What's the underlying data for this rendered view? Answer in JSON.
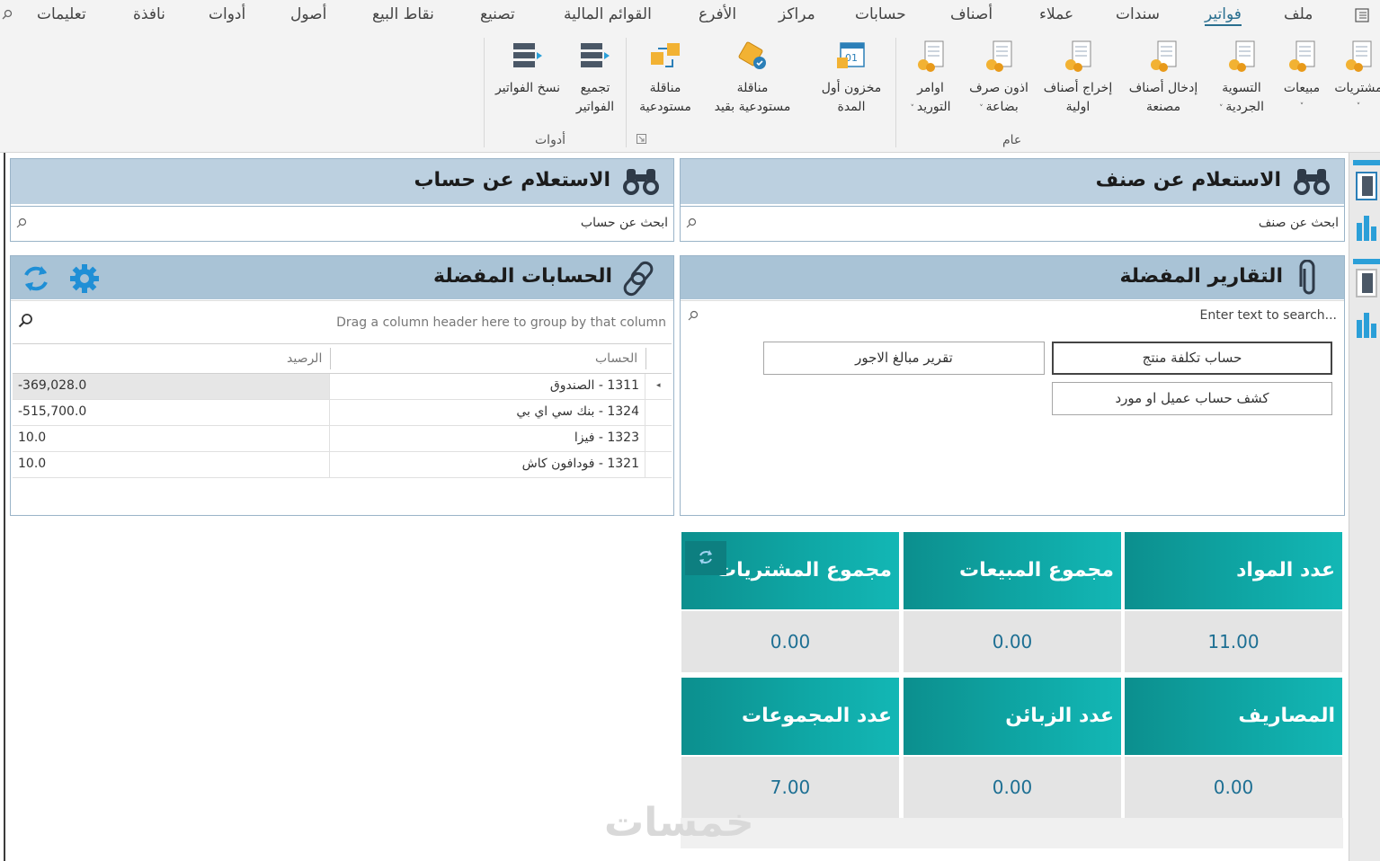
{
  "menu": {
    "items": [
      "ملف",
      "فواتير",
      "سندات",
      "عملاء",
      "أصناف",
      "حسابات",
      "مراكز",
      "الأفرع",
      "القوائم المالية",
      "تصنيع",
      "نقاط البيع",
      "أصول",
      "أدوات",
      "نافذة",
      "تعليمات"
    ],
    "active": "فواتير"
  },
  "ribbon": {
    "buttons": [
      {
        "line1": "مشتريات",
        "line2": "",
        "dropdown": true
      },
      {
        "line1": "مبيعات",
        "line2": "",
        "dropdown": true
      },
      {
        "line1": "التسوية",
        "line2": "الجردية",
        "dropdown": true
      },
      {
        "line1": "إدخال أصناف",
        "line2": "مصنعة",
        "dropdown": false
      },
      {
        "line1": "إخراج أصناف",
        "line2": "اولية",
        "dropdown": false
      },
      {
        "line1": "اذون صرف",
        "line2": "بضاعة",
        "dropdown": true
      },
      {
        "line1": "اوامر",
        "line2": "التوريد",
        "dropdown": true
      },
      {
        "line1": "مخزون أول",
        "line2": "المدة",
        "dropdown": false
      },
      {
        "line1": "مناقلة",
        "line2": "مستودعية بقيد",
        "dropdown": false
      },
      {
        "line1": "مناقلة",
        "line2": "مستودعية",
        "dropdown": false
      },
      {
        "line1": "تجميع",
        "line2": "الفواتير",
        "dropdown": false
      },
      {
        "line1": "نسخ الفواتير",
        "line2": "",
        "dropdown": false
      }
    ],
    "groups": {
      "general": "عام",
      "tools": "أدوات"
    }
  },
  "item_search": {
    "title": "الاستعلام عن صنف",
    "placeholder": "ابحث عن صنف"
  },
  "account_search": {
    "title": "الاستعلام عن حساب",
    "placeholder": "ابحث عن حساب"
  },
  "fav_reports": {
    "title": "التقارير المفضلة",
    "search_placeholder": "Enter text to search...",
    "buttons": [
      "حساب تكلفة منتج",
      "تقرير مبالغ الاجور",
      "كشف حساب عميل او مورد"
    ]
  },
  "fav_accounts": {
    "title": "الحسابات المفضلة",
    "group_hint": "Drag a column header here to group by that column",
    "columns": {
      "account": "الحساب",
      "balance": "الرصيد"
    },
    "rows": [
      {
        "account": "1311 - الصندوق",
        "balance": "-369,028.0"
      },
      {
        "account": "1324 - بنك سي اي بي",
        "balance": "-515,700.0"
      },
      {
        "account": "1323 - فيزا",
        "balance": "10.0"
      },
      {
        "account": "1321 - فودافون كاش",
        "balance": "10.0"
      }
    ]
  },
  "stats": [
    {
      "label": "عدد المواد",
      "value": "11.00"
    },
    {
      "label": "مجموع المبيعات",
      "value": "0.00"
    },
    {
      "label": "مجموع المشتريات",
      "value": "0.00"
    },
    {
      "label": "المصاريف",
      "value": "0.00"
    },
    {
      "label": "عدد الزبائن",
      "value": "0.00"
    },
    {
      "label": "عدد المجموعات",
      "value": "7.00"
    }
  ],
  "watermark": "خمسات",
  "colors": {
    "tile": "#0fa8a6",
    "value_text": "#1d6f93",
    "panel_head": "#bcd0e0",
    "accent": "#2a6f8f"
  }
}
